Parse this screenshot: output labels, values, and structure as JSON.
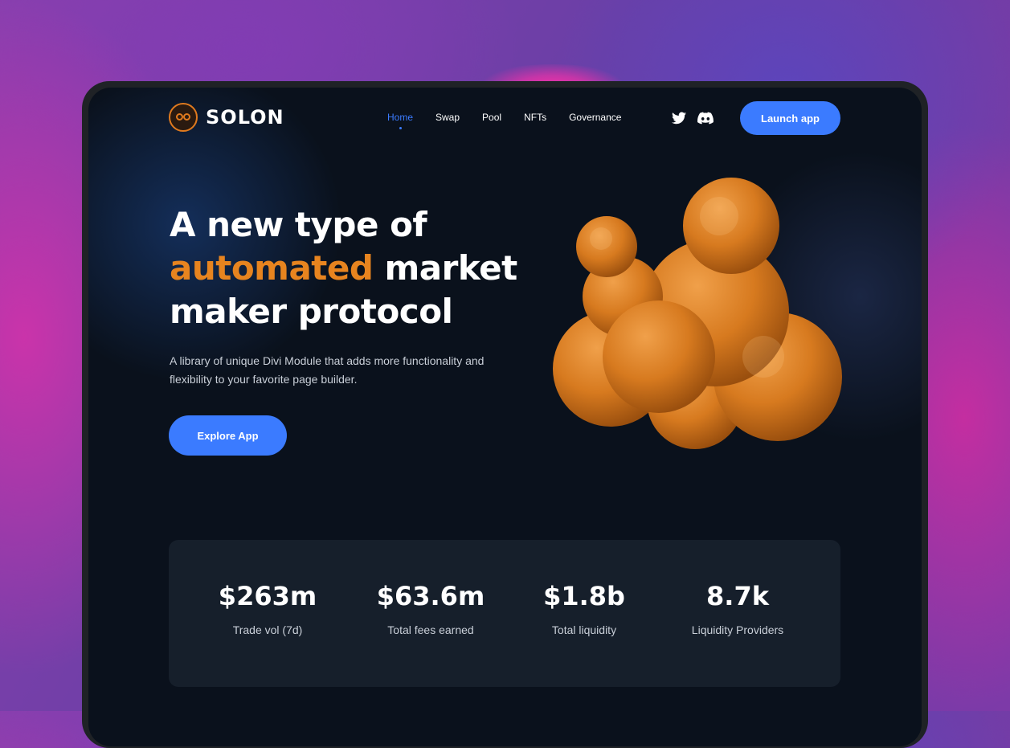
{
  "brand": {
    "name": "SOLON",
    "accent_color": "#e7841f",
    "primary_color": "#3b7bff"
  },
  "nav": {
    "items": [
      {
        "label": "Home",
        "active": true
      },
      {
        "label": "Swap"
      },
      {
        "label": "Pool"
      },
      {
        "label": "NFTs"
      },
      {
        "label": "Governance"
      }
    ],
    "social": [
      "twitter-icon",
      "discord-icon"
    ],
    "cta_label": "Launch app"
  },
  "hero": {
    "title_line1": "A new type of",
    "title_accent": "automated",
    "title_line2_rest": "market",
    "title_line3": "maker protocol",
    "subtitle": "A library of unique Divi Module that adds more functionality and flexibility to your favorite page builder.",
    "button_label": "Explore App",
    "illustration": "orange-3d-blob"
  },
  "stats": [
    {
      "value": "$263m",
      "label": "Trade vol (7d)"
    },
    {
      "value": "$63.6m",
      "label": "Total fees earned"
    },
    {
      "value": "$1.8b",
      "label": "Total liquidity"
    },
    {
      "value": "8.7k",
      "label": "Liquidity Providers"
    }
  ]
}
